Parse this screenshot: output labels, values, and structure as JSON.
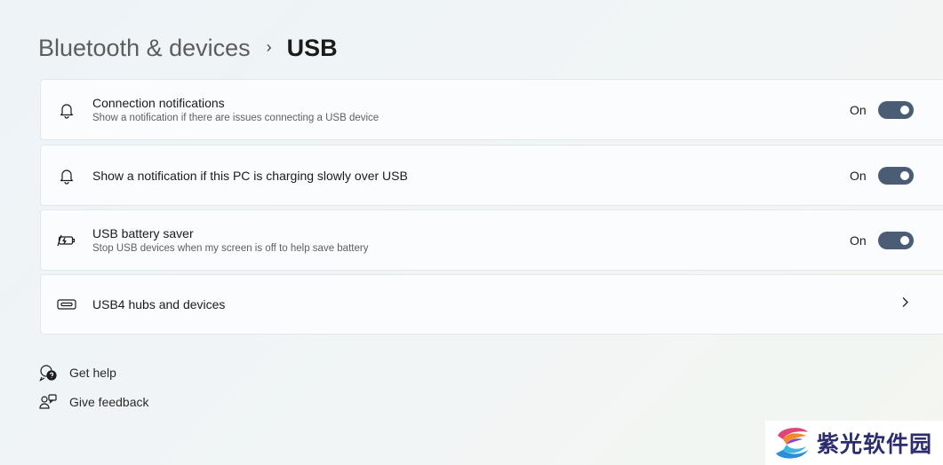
{
  "breadcrumb": {
    "parent": "Bluetooth & devices",
    "separator": "›",
    "current": "USB"
  },
  "cards": [
    {
      "title": "Connection notifications",
      "subtitle": "Show a notification if there are issues connecting a USB device",
      "state": "On",
      "icon": "bell-icon",
      "toggle_on": true
    },
    {
      "title": "Show a notification if this PC is charging slowly over USB",
      "state": "On",
      "icon": "bell-icon",
      "toggle_on": true
    },
    {
      "title": "USB battery saver",
      "subtitle": "Stop USB devices when my screen is off to help save battery",
      "state": "On",
      "icon": "battery-saver-icon",
      "toggle_on": true
    },
    {
      "title": "USB4 hubs and devices",
      "icon": "usb-port-icon",
      "chevron": "chevron-right-icon"
    }
  ],
  "links": [
    {
      "label": "Get help",
      "icon": "help-icon"
    },
    {
      "label": "Give feedback",
      "icon": "feedback-icon"
    }
  ],
  "watermark": {
    "text": "紫光软件园",
    "icon": "logo-icon"
  },
  "colors": {
    "toggle_on": "#4a5d75",
    "accent_text": "#1b1b1b"
  }
}
